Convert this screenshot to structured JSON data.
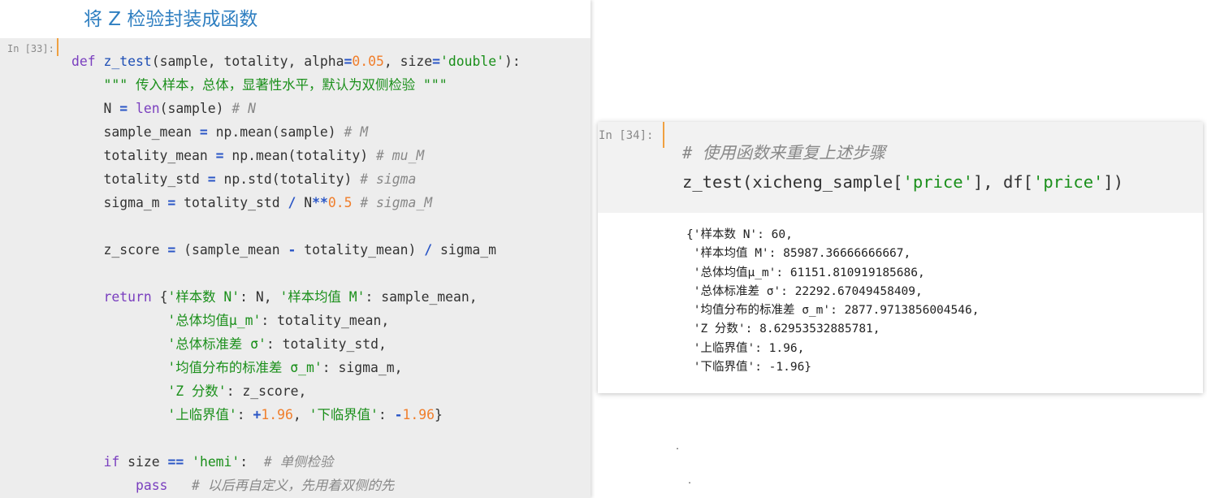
{
  "heading": "将 Z 检验封装成函数",
  "cell1": {
    "prompt": "In [33]:",
    "lines": [
      [
        [
          "kw",
          "def "
        ],
        [
          "fn",
          "z_test"
        ],
        [
          "p",
          "(sample, totality, alpha"
        ],
        [
          "op",
          "="
        ],
        [
          "num",
          "0.05"
        ],
        [
          "p",
          ", size"
        ],
        [
          "op",
          "="
        ],
        [
          "str",
          "'double'"
        ],
        [
          "p",
          "):"
        ]
      ],
      [
        [
          "p",
          "    "
        ],
        [
          "str",
          "\"\"\" 传入样本，总体，显著性水平，默认为双侧检验 \"\"\""
        ]
      ],
      [
        [
          "p",
          "    N "
        ],
        [
          "op",
          "="
        ],
        [
          "p",
          " "
        ],
        [
          "kw",
          "len"
        ],
        [
          "p",
          "(sample) "
        ],
        [
          "cm",
          "# N"
        ]
      ],
      [
        [
          "p",
          "    sample_mean "
        ],
        [
          "op",
          "="
        ],
        [
          "p",
          " np.mean(sample) "
        ],
        [
          "cm",
          "# M"
        ]
      ],
      [
        [
          "p",
          "    totality_mean "
        ],
        [
          "op",
          "="
        ],
        [
          "p",
          " np.mean(totality) "
        ],
        [
          "cm",
          "# mu_M"
        ]
      ],
      [
        [
          "p",
          "    totality_std "
        ],
        [
          "op",
          "="
        ],
        [
          "p",
          " np.std(totality) "
        ],
        [
          "cm",
          "# sigma"
        ]
      ],
      [
        [
          "p",
          "    sigma_m "
        ],
        [
          "op",
          "="
        ],
        [
          "p",
          " totality_std "
        ],
        [
          "op",
          "/"
        ],
        [
          "p",
          " N"
        ],
        [
          "op",
          "**"
        ],
        [
          "num",
          "0.5"
        ],
        [
          "p",
          " "
        ],
        [
          "cm",
          "# sigma_M"
        ]
      ],
      [
        [
          "p",
          ""
        ]
      ],
      [
        [
          "p",
          "    z_score "
        ],
        [
          "op",
          "="
        ],
        [
          "p",
          " (sample_mean "
        ],
        [
          "op",
          "-"
        ],
        [
          "p",
          " totality_mean) "
        ],
        [
          "op",
          "/"
        ],
        [
          "p",
          " sigma_m"
        ]
      ],
      [
        [
          "p",
          ""
        ]
      ],
      [
        [
          "p",
          "    "
        ],
        [
          "kw",
          "return"
        ],
        [
          "p",
          " {"
        ],
        [
          "str",
          "'样本数 N'"
        ],
        [
          "p",
          ": N, "
        ],
        [
          "str",
          "'样本均值 M'"
        ],
        [
          "p",
          ": sample_mean,"
        ]
      ],
      [
        [
          "p",
          "            "
        ],
        [
          "str",
          "'总体均值μ_m'"
        ],
        [
          "p",
          ": totality_mean,"
        ]
      ],
      [
        [
          "p",
          "            "
        ],
        [
          "str",
          "'总体标准差 σ'"
        ],
        [
          "p",
          ": totality_std,"
        ]
      ],
      [
        [
          "p",
          "            "
        ],
        [
          "str",
          "'均值分布的标准差 σ_m'"
        ],
        [
          "p",
          ": sigma_m,"
        ]
      ],
      [
        [
          "p",
          "            "
        ],
        [
          "str",
          "'Z 分数'"
        ],
        [
          "p",
          ": z_score,"
        ]
      ],
      [
        [
          "p",
          "            "
        ],
        [
          "str",
          "'上临界值'"
        ],
        [
          "p",
          ": "
        ],
        [
          "op",
          "+"
        ],
        [
          "num",
          "1.96"
        ],
        [
          "p",
          ", "
        ],
        [
          "str",
          "'下临界值'"
        ],
        [
          "p",
          ": "
        ],
        [
          "op",
          "-"
        ],
        [
          "num",
          "1.96"
        ],
        [
          "p",
          "}"
        ]
      ],
      [
        [
          "p",
          ""
        ]
      ],
      [
        [
          "p",
          "    "
        ],
        [
          "kw",
          "if"
        ],
        [
          "p",
          " size "
        ],
        [
          "op",
          "=="
        ],
        [
          "p",
          " "
        ],
        [
          "str",
          "'hemi'"
        ],
        [
          "p",
          ":  "
        ],
        [
          "cm",
          "# 单侧检验"
        ]
      ],
      [
        [
          "p",
          "        "
        ],
        [
          "kw",
          "pass"
        ],
        [
          "p",
          "   "
        ],
        [
          "cm",
          "# 以后再自定义，先用着双侧的先"
        ]
      ]
    ]
  },
  "cell2": {
    "prompt": "In [34]:",
    "lines": [
      [
        [
          "cm",
          "# 使用函数来重复上述步骤"
        ]
      ],
      [
        [
          "p",
          "z_test(xicheng_sample["
        ],
        [
          "str",
          "'price'"
        ],
        [
          "p",
          "], df["
        ],
        [
          "str",
          "'price'"
        ],
        [
          "p",
          "])"
        ]
      ]
    ],
    "output": [
      "{'样本数 N': 60,",
      " '样本均值 M': 85987.36666666667,",
      " '总体均值μ_m': 61151.810919185686,",
      " '总体标准差 σ': 22292.67049458409,",
      " '均值分布的标准差 σ_m': 2877.9713856004546,",
      " 'Z 分数': 8.62953532885781,",
      " '上临界值': 1.96,",
      " '下临界值': -1.96}"
    ]
  }
}
